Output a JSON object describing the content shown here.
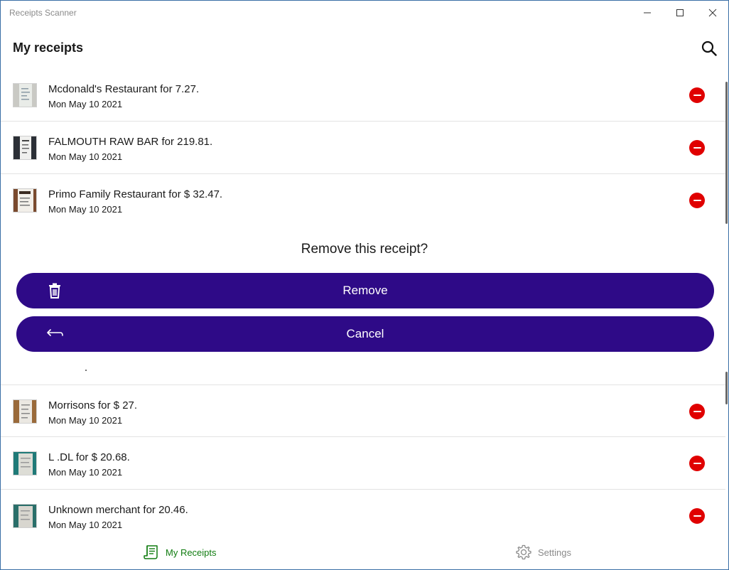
{
  "window": {
    "title": "Receipts Scanner",
    "controls": [
      "minimize-icon",
      "maximize-icon",
      "close-icon"
    ]
  },
  "header": {
    "title": "My receipts",
    "search_icon": "search-icon"
  },
  "receipts": [
    {
      "title": "Mcdonald's Restaurant for 7.27.",
      "date": "Mon May 10 2021"
    },
    {
      "title": "FALMOUTH RAW BAR for 219.81.",
      "date": "Mon May 10 2021"
    },
    {
      "title": "Primo Family Restaurant for $ 32.47.",
      "date": "Mon May 10 2021"
    },
    {
      "title": "Morrisons for $ 27.",
      "date": "Mon May 10 2021"
    },
    {
      "title": "L .DL for $ 20.68.",
      "date": "Mon May 10 2021"
    },
    {
      "title": "Unknown merchant for 20.46.",
      "date": "Mon May 10 2021"
    }
  ],
  "confirm": {
    "question": "Remove this receipt?",
    "remove_label": "Remove",
    "cancel_label": "Cancel",
    "remove_icon": "trash-icon",
    "cancel_icon": "undo-arrow-icon"
  },
  "bottom_nav": {
    "receipts_label": "My Receipts",
    "settings_label": "Settings",
    "receipts_icon": "receipt-icon",
    "settings_icon": "gear-icon"
  },
  "colors": {
    "accent_purple": "#2e0a87",
    "delete_red": "#e00000",
    "nav_active_green": "#107c10",
    "window_border": "#3a6ea5"
  }
}
